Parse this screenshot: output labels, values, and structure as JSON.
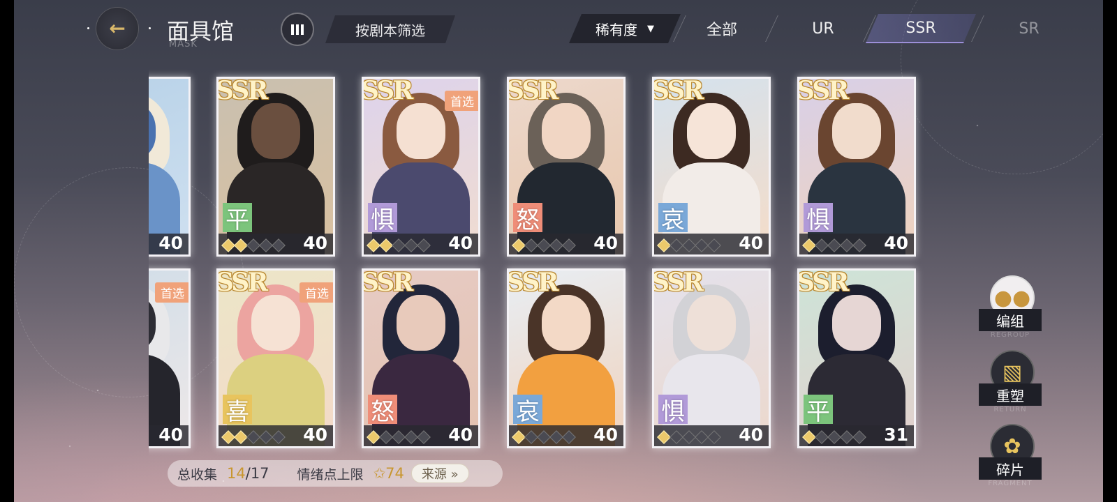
{
  "header": {
    "title": "面具馆",
    "subtitle": "MASK",
    "script_filter_label": "按剧本筛选",
    "rarity_sort_label": "稀有度",
    "rarity_tabs": [
      {
        "label": "全部",
        "active": false
      },
      {
        "label": "UR",
        "active": false
      },
      {
        "label": "SSR",
        "active": true
      },
      {
        "label": "SR",
        "active": false
      }
    ]
  },
  "cards": [
    {
      "rarity": "SSR",
      "emotion": "",
      "level": "40",
      "stars": 0,
      "pick": "",
      "palette": [
        "#b8d2e8",
        "#f1e9d8",
        "#4a72b0",
        "#cfe0f0",
        "#6a93c8"
      ],
      "partial": true
    },
    {
      "rarity": "SSR",
      "emotion": "平",
      "emotion_color": "#7cc47c",
      "level": "40",
      "stars": 2,
      "pick": "",
      "palette": [
        "#c9c0b0",
        "#1f1c1c",
        "#6a4f3f",
        "#d9c0a0",
        "#2a2626"
      ]
    },
    {
      "rarity": "SSR",
      "emotion": "惧",
      "emotion_color": "#b19ad8",
      "level": "40",
      "stars": 2,
      "pick": "首选",
      "palette": [
        "#ddd3ec",
        "#8a5a40",
        "#f5e0d2",
        "#f0dcd0",
        "#4b4a6e"
      ]
    },
    {
      "rarity": "SSR",
      "emotion": "怒",
      "emotion_color": "#ef8d78",
      "level": "40",
      "stars": 1,
      "pick": "",
      "palette": [
        "#ecd8cc",
        "#6b6158",
        "#f1d6c4",
        "#e8c7ac",
        "#222830"
      ]
    },
    {
      "rarity": "SSR",
      "emotion": "哀",
      "emotion_color": "#7aa8d8",
      "level": "40",
      "stars": 1,
      "pick": "",
      "palette": [
        "#d4e2ee",
        "#3d2a22",
        "#f6e4d8",
        "#f5dcc8",
        "#f2ece8"
      ]
    },
    {
      "rarity": "SSR",
      "emotion": "惧",
      "emotion_color": "#b19ad8",
      "level": "40",
      "stars": 1,
      "pick": "",
      "palette": [
        "#d8d0e8",
        "#6a4530",
        "#f1dccc",
        "#efd2bd",
        "#2a3440"
      ]
    },
    {
      "rarity": "SSR",
      "emotion": "",
      "level": "40",
      "stars": 0,
      "pick": "首选",
      "palette": [
        "#d0dde8",
        "#e8e8ea",
        "#2c2c34",
        "#eee8e8",
        "#25252c"
      ],
      "partial": true
    },
    {
      "rarity": "SSR",
      "emotion": "喜",
      "emotion_color": "#e8c45e",
      "level": "40",
      "stars": 2,
      "pick": "首选",
      "palette": [
        "#ece6c8",
        "#eca4a0",
        "#f6e2d4",
        "#f3d9c8",
        "#dcd080"
      ]
    },
    {
      "rarity": "SSR",
      "emotion": "怒",
      "emotion_color": "#ef8d78",
      "level": "40",
      "stars": 1,
      "pick": "",
      "palette": [
        "#e6cbc4",
        "#22263a",
        "#e8cabb",
        "#e4c2b0",
        "#3a2840"
      ]
    },
    {
      "rarity": "SSR",
      "emotion": "哀",
      "emotion_color": "#7aa8d8",
      "level": "40",
      "stars": 1,
      "pick": "",
      "palette": [
        "#e8eef4",
        "#4a3428",
        "#f3d9c6",
        "#f0d2bc",
        "#f2a040"
      ]
    },
    {
      "rarity": "SSR",
      "emotion": "惧",
      "emotion_color": "#b19ad8",
      "level": "40",
      "stars": 1,
      "pick": "",
      "palette": [
        "#e4e2ec",
        "#d2d2d6",
        "#eee0d8",
        "#ecd8cc",
        "#e8e6ec"
      ]
    },
    {
      "rarity": "SSR",
      "emotion": "平",
      "emotion_color": "#7cc47c",
      "level": "31",
      "stars": 1,
      "pick": "",
      "palette": [
        "#cde4d8",
        "#1c1e2e",
        "#e6d6d4",
        "#e2d0cc",
        "#2c2a34"
      ]
    }
  ],
  "side_buttons": [
    {
      "name": "group",
      "label": "编组",
      "sub": "REGROUP",
      "icon": "group-icon"
    },
    {
      "name": "reshape",
      "label": "重塑",
      "sub": "RETURN",
      "icon": "reshape-icon"
    },
    {
      "name": "fragment",
      "label": "碎片",
      "sub": "FRAGMENT",
      "icon": "puzzle-icon"
    }
  ],
  "footer": {
    "collect_label": "总收集",
    "collect_current": "14",
    "collect_total": "/17",
    "mood_label": "情绪点上限",
    "mood_value": "74",
    "source_label": "来源 »"
  },
  "colors": {
    "accent_gold": "#c8962e",
    "active_tab": "#9c8fd8"
  }
}
